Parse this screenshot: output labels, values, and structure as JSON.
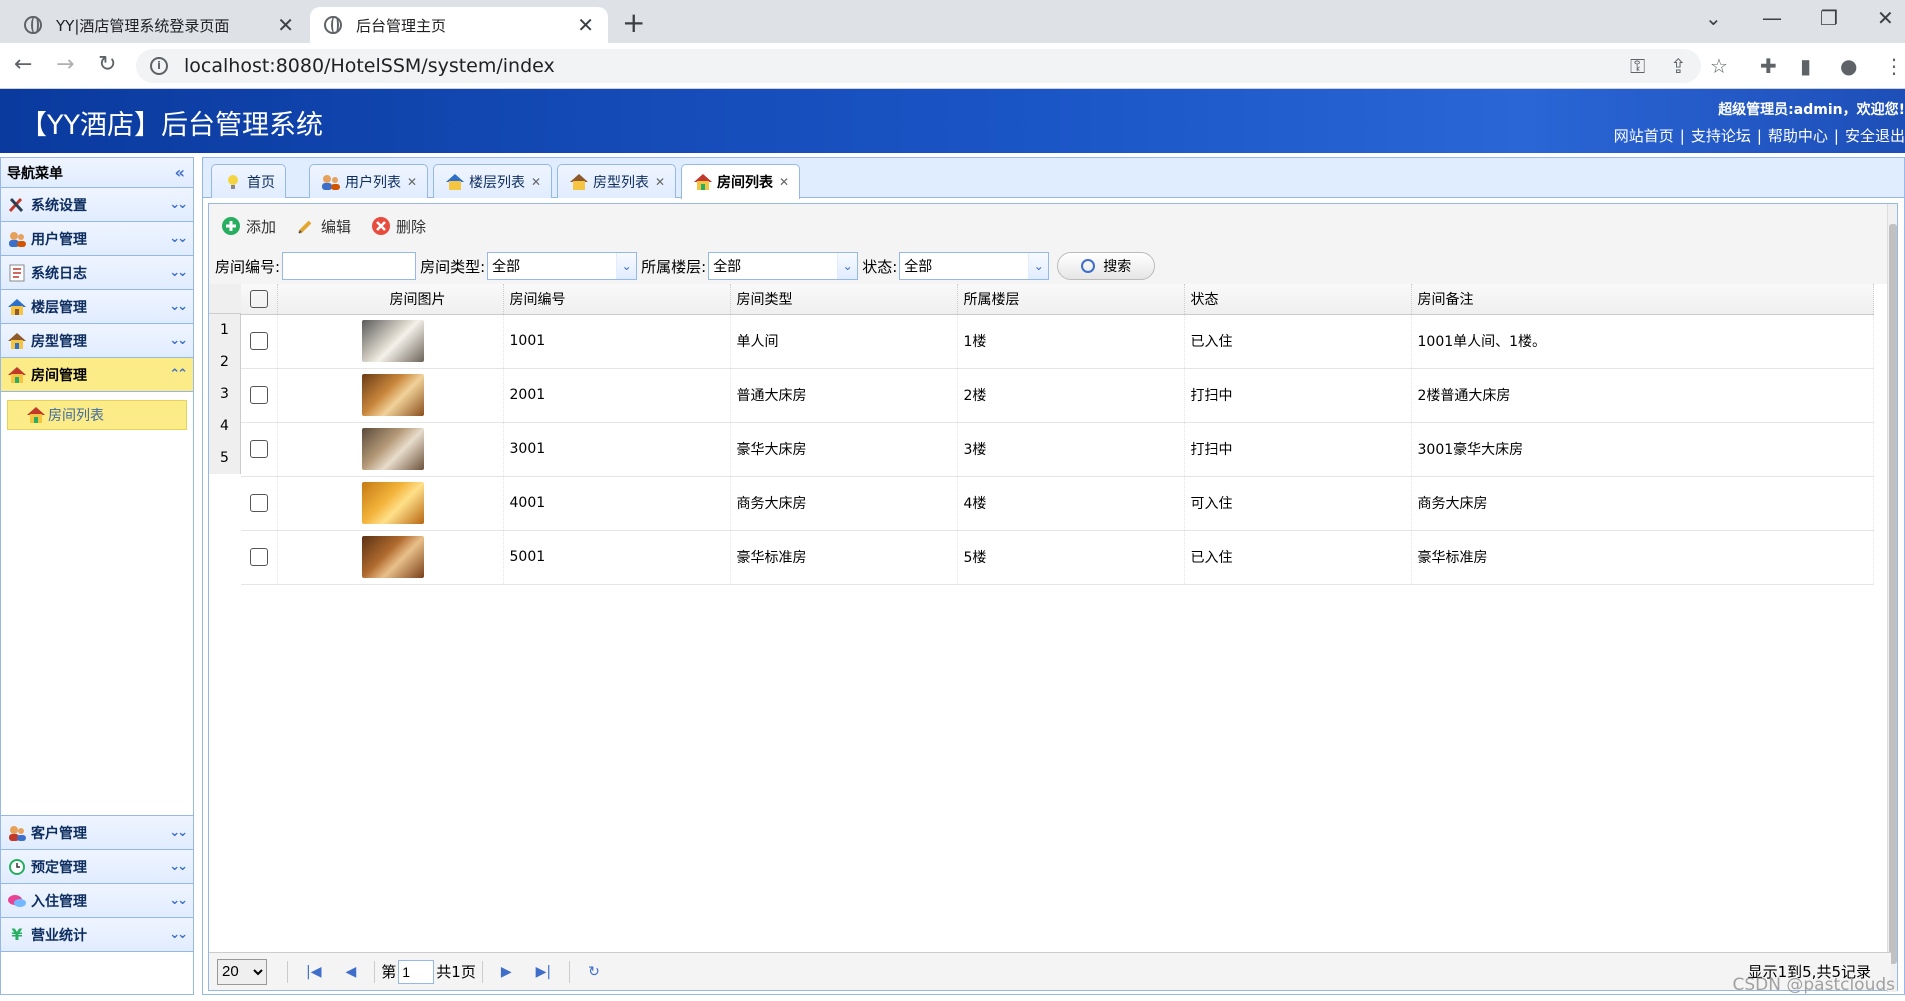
{
  "browser": {
    "tabs": [
      {
        "title": "YY|酒店管理系统登录页面",
        "active": false
      },
      {
        "title": "后台管理主页",
        "active": true
      }
    ],
    "url": "localhost:8080/HotelSSM/system/index"
  },
  "header": {
    "title": "【YY酒店】后台管理系统",
    "welcome": "超级管理员:admin，欢迎您!",
    "links": [
      "网站首页",
      "支持论坛",
      "帮助中心",
      "安全退出"
    ]
  },
  "sidebar": {
    "title": "导航菜单",
    "top_items": [
      {
        "label": "系统设置"
      },
      {
        "label": "用户管理"
      },
      {
        "label": "系统日志"
      },
      {
        "label": "楼层管理"
      },
      {
        "label": "房型管理"
      },
      {
        "label": "房间管理",
        "selected": true
      }
    ],
    "sub_items": [
      {
        "label": "房间列表"
      }
    ],
    "bottom_items": [
      {
        "label": "客户管理"
      },
      {
        "label": "预定管理"
      },
      {
        "label": "入住管理"
      },
      {
        "label": "营业统计"
      }
    ]
  },
  "tabs": [
    {
      "label": "首页",
      "closable": false
    },
    {
      "label": "用户列表",
      "closable": true
    },
    {
      "label": "楼层列表",
      "closable": true
    },
    {
      "label": "房型列表",
      "closable": true
    },
    {
      "label": "房间列表",
      "closable": true,
      "active": true
    }
  ],
  "toolbar": {
    "add": "添加",
    "edit": "编辑",
    "delete": "删除"
  },
  "search": {
    "room_no_label": "房间编号:",
    "room_no_value": "",
    "room_type_label": "房间类型:",
    "room_type_value": "全部",
    "floor_label": "所属楼层:",
    "floor_value": "全部",
    "status_label": "状态:",
    "status_value": "全部",
    "button": "搜索"
  },
  "table": {
    "columns": [
      "房间图片",
      "房间编号",
      "房间类型",
      "所属楼层",
      "状态",
      "房间备注"
    ],
    "row_numbers": [
      "1",
      "2",
      "3",
      "4",
      "5"
    ],
    "rows": [
      {
        "no": "1001",
        "type": "单人间",
        "floor": "1楼",
        "status": "已入住",
        "remark": "1001单人间、1楼。"
      },
      {
        "no": "2001",
        "type": "普通大床房",
        "floor": "2楼",
        "status": "打扫中",
        "remark": "2楼普通大床房"
      },
      {
        "no": "3001",
        "type": "豪华大床房",
        "floor": "3楼",
        "status": "打扫中",
        "remark": "3001豪华大床房"
      },
      {
        "no": "4001",
        "type": "商务大床房",
        "floor": "4楼",
        "status": "可入住",
        "remark": "商务大床房"
      },
      {
        "no": "5001",
        "type": "豪华标准房",
        "floor": "5楼",
        "status": "已入住",
        "remark": "豪华标准房"
      }
    ]
  },
  "pager": {
    "page_size": "20",
    "page_prefix": "第",
    "page_value": "1",
    "page_total": "共1页",
    "info": "显示1到5,共5记录"
  },
  "watermark": "CSDN @pastclouds",
  "colors": {
    "header_blue": "#1b56c7",
    "selected_yellow": "#fbec88",
    "border_blue": "#95b8e7"
  }
}
